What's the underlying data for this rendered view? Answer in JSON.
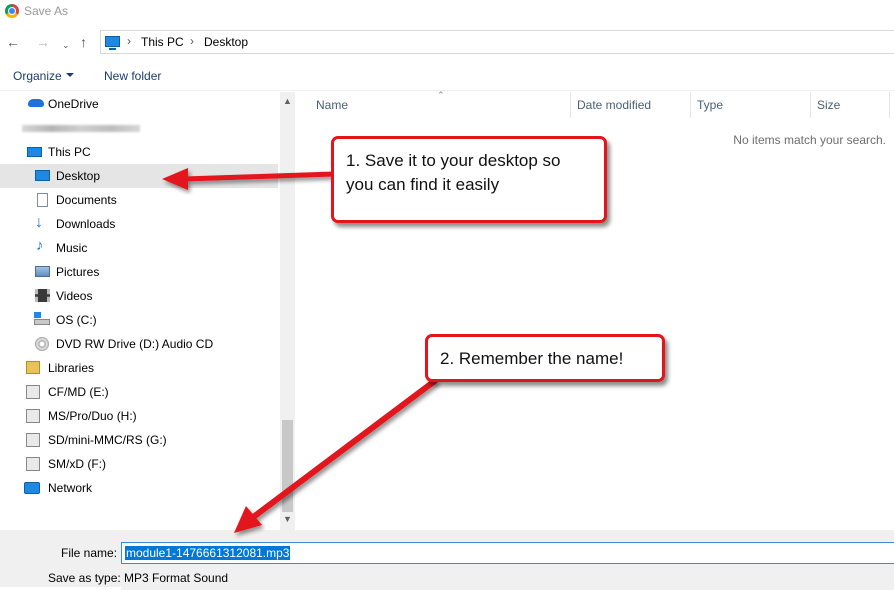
{
  "window": {
    "title": "Save As",
    "icon": "chrome-icon"
  },
  "address": {
    "segments": [
      "This PC",
      "Desktop"
    ]
  },
  "toolbar": {
    "organize": "Organize",
    "new_folder": "New folder"
  },
  "nav": {
    "items": [
      {
        "label": "OneDrive",
        "icon": "onedrive-icon"
      },
      {
        "label": "",
        "icon": "blurred-account"
      },
      {
        "label": "This PC",
        "icon": "pc-icon"
      },
      {
        "label": "Desktop",
        "icon": "desktop-icon",
        "selected": true
      },
      {
        "label": "Documents",
        "icon": "documents-icon"
      },
      {
        "label": "Downloads",
        "icon": "downloads-icon"
      },
      {
        "label": "Music",
        "icon": "music-icon"
      },
      {
        "label": "Pictures",
        "icon": "pictures-icon"
      },
      {
        "label": "Videos",
        "icon": "videos-icon"
      },
      {
        "label": "OS (C:)",
        "icon": "drive-icon"
      },
      {
        "label": "DVD RW Drive (D:) Audio CD",
        "icon": "dvd-icon"
      },
      {
        "label": "Libraries",
        "icon": "libraries-icon"
      },
      {
        "label": "CF/MD (E:)",
        "icon": "removable-drive-icon"
      },
      {
        "label": "MS/Pro/Duo (H:)",
        "icon": "removable-drive-icon"
      },
      {
        "label": "SD/mini-MMC/RS (G:)",
        "icon": "removable-drive-icon"
      },
      {
        "label": "SM/xD (F:)",
        "icon": "removable-drive-icon"
      },
      {
        "label": "Network",
        "icon": "network-icon"
      }
    ]
  },
  "filelist": {
    "columns": [
      "Name",
      "Date modified",
      "Type",
      "Size"
    ],
    "empty_message": "No items match your search."
  },
  "form": {
    "filename_label": "File name:",
    "filename_value": "module1-1476661312081.mp3",
    "savetype_label": "Save as type:",
    "savetype_value": "MP3 Format Sound"
  },
  "callouts": {
    "first": "1. Save it to your desktop so you can find it easily",
    "second": "2. Remember the name!"
  },
  "colors": {
    "accent": "#0078d7",
    "annotation": "#e2141c",
    "selection": "#e5e5e5"
  }
}
